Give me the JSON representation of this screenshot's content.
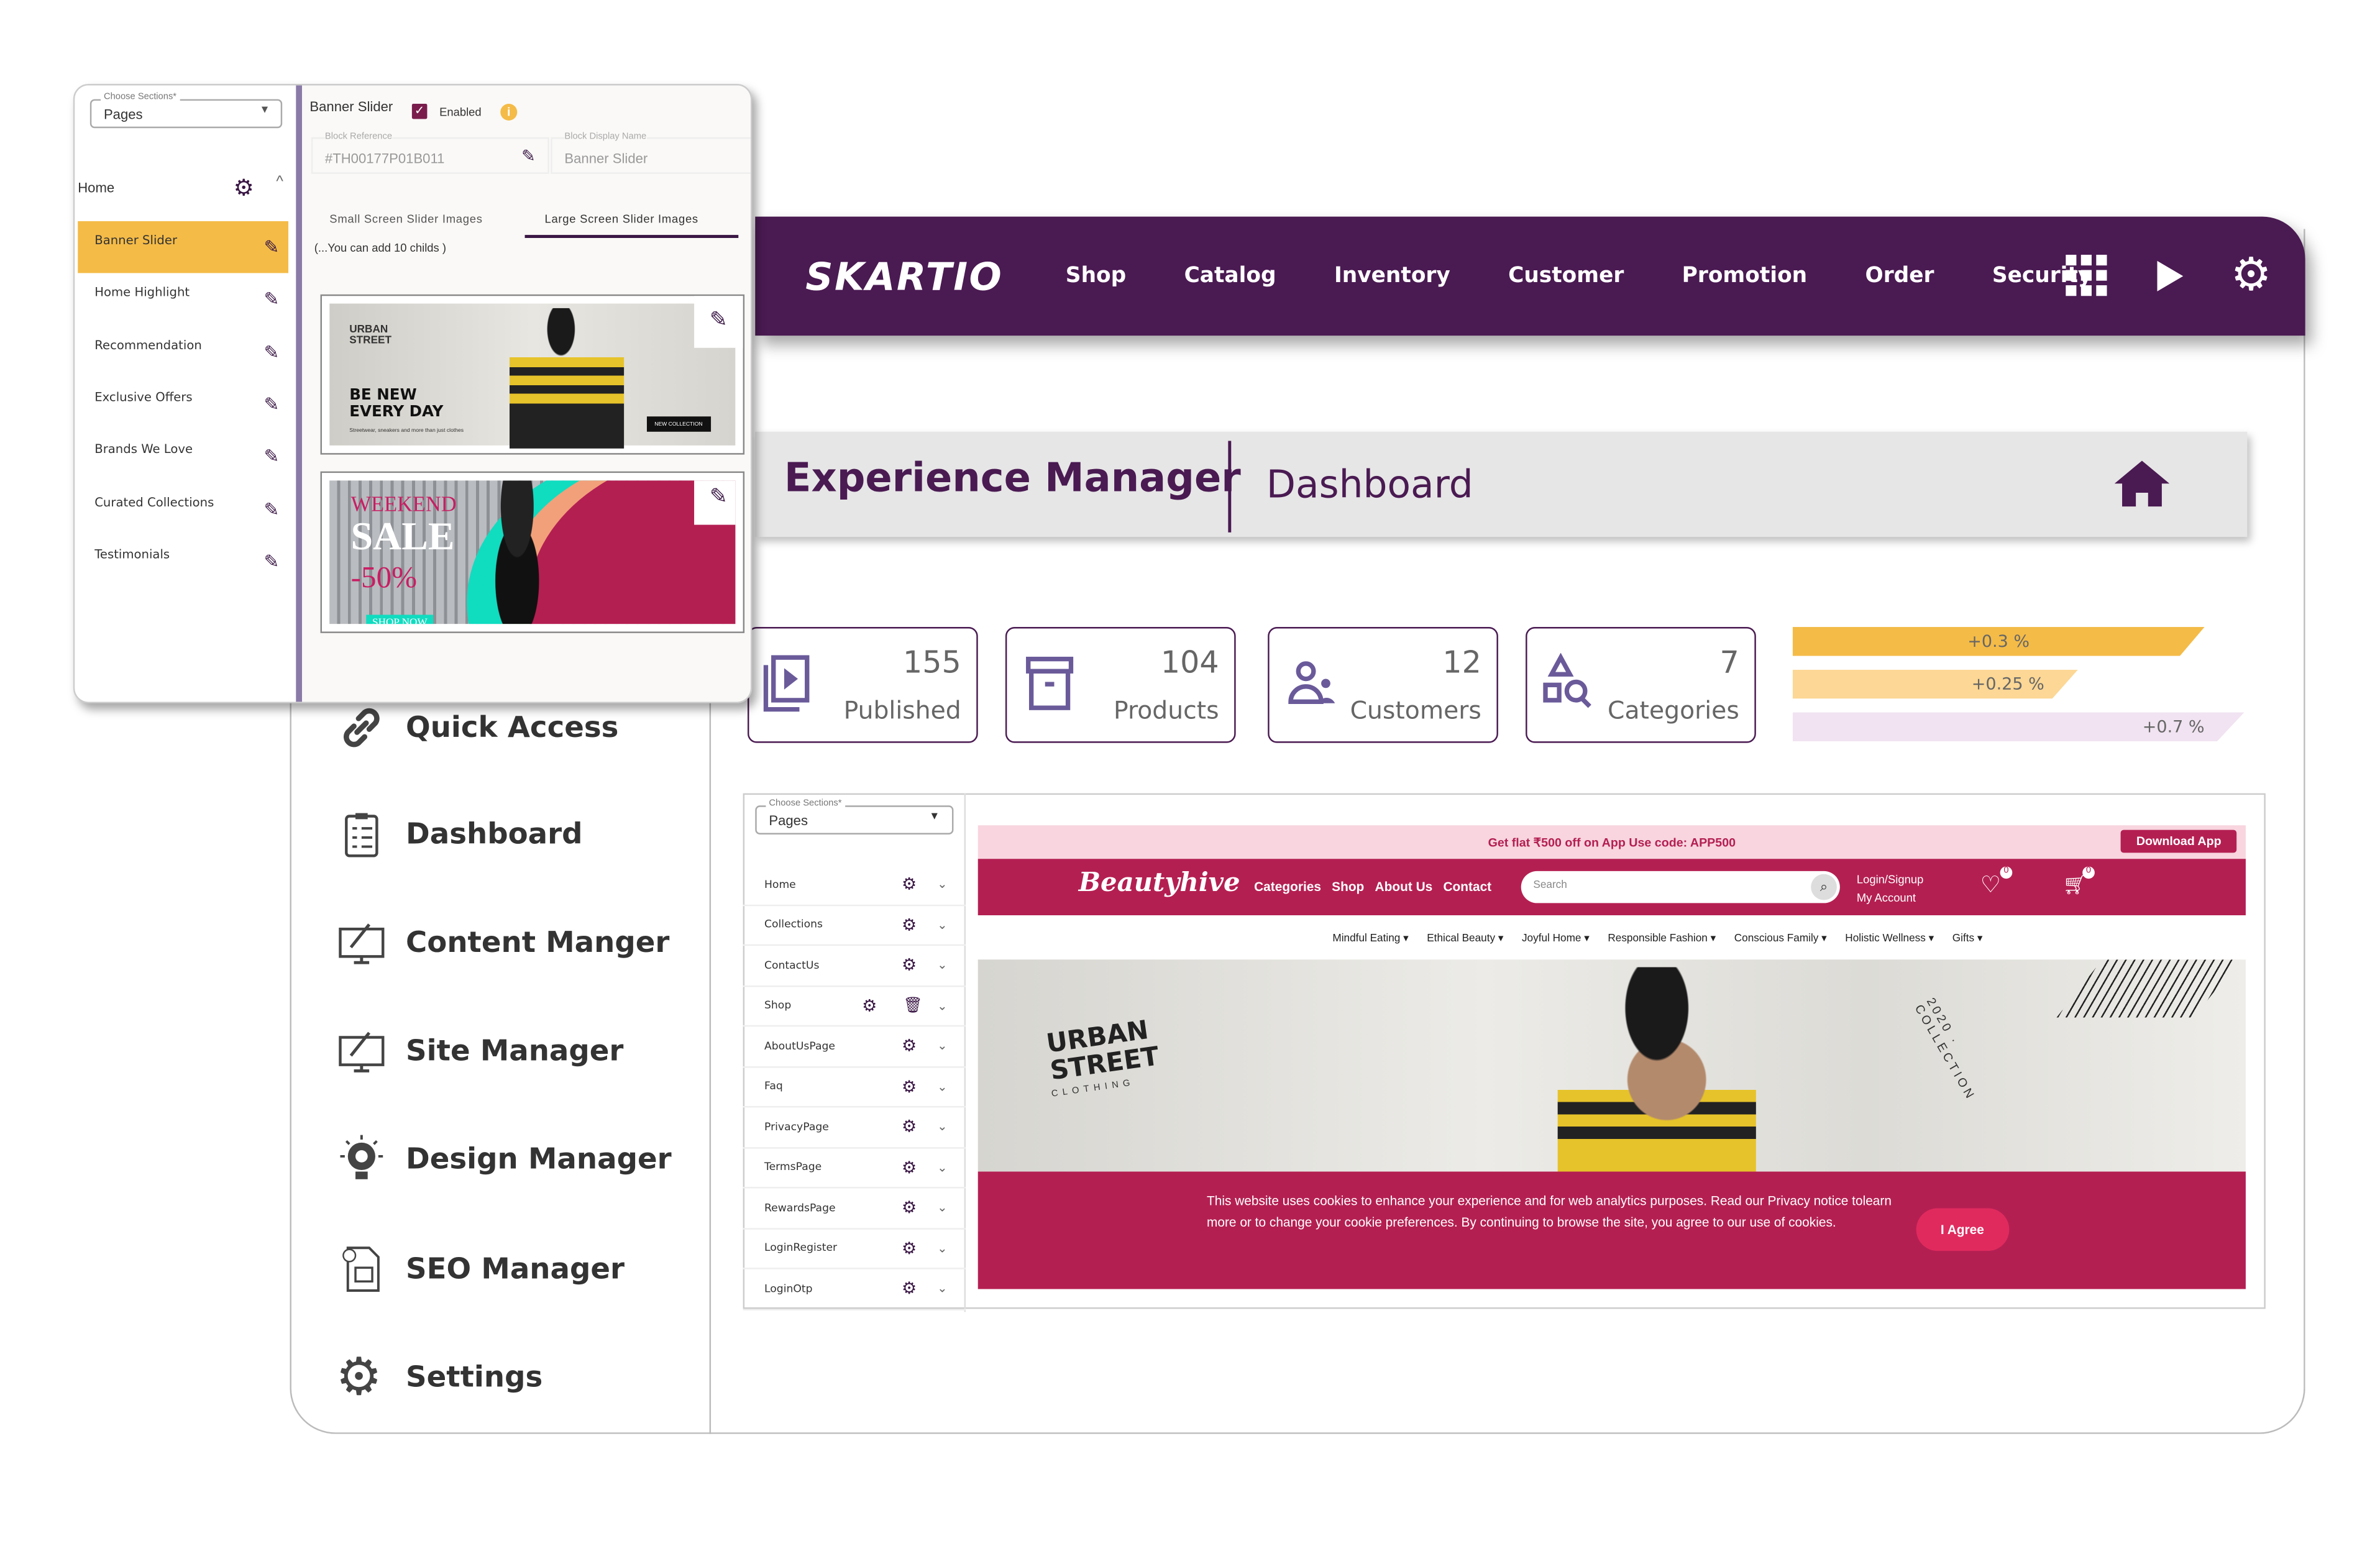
{
  "colors": {
    "brand": "#4a1a52",
    "accent": "#f4bb47",
    "site": "#b41f52",
    "promo_bg": "#f8d5df"
  },
  "navbar": {
    "logo": "SKARTIO",
    "items": [
      "Shop",
      "Catalog",
      "Inventory",
      "Customer",
      "Promotion",
      "Order",
      "Security"
    ],
    "icons": [
      "grid-icon",
      "play-icon",
      "gear-icon"
    ]
  },
  "sidebar": {
    "items": [
      {
        "label": "Quick Access",
        "icon": "link-icon"
      },
      {
        "label": "Dashboard",
        "icon": "clipboard-icon"
      },
      {
        "label": "Content Manger",
        "icon": "pen-monitor-icon"
      },
      {
        "label": "Site Manager",
        "icon": "pen-monitor-icon"
      },
      {
        "label": "Design Manager",
        "icon": "lightbulb-icon"
      },
      {
        "label": "SEO Manager",
        "icon": "seo-document-icon"
      },
      {
        "label": "Settings",
        "icon": "gear-icon"
      }
    ]
  },
  "header": {
    "title": "Experience Manager",
    "subtitle": "Dashboard",
    "icon": "home-icon"
  },
  "stats": [
    {
      "value": "155",
      "label": "Published"
    },
    {
      "value": "104",
      "label": "Products"
    },
    {
      "value": "12",
      "label": "Customers"
    },
    {
      "value": "7",
      "label": "Categories"
    }
  ],
  "trends": [
    {
      "label": "+0.3 %",
      "color": "#f4bb47"
    },
    {
      "label": "+0.25 %",
      "color": "#fcd795"
    },
    {
      "label": "+0.7 %",
      "color": "#f1e3f1"
    }
  ],
  "preview": {
    "section_legend": "Choose Sections*",
    "section_value": "Pages",
    "pages": [
      "Home",
      "Collections",
      "ContactUs",
      "Shop",
      "AboutUsPage",
      "Faq",
      "PrivacyPage",
      "TermsPage",
      "RewardsPage",
      "LoginRegister",
      "LoginOtp"
    ],
    "site": {
      "promo": "Get flat ₹500 off on App Use code: APP500",
      "download": "Download App",
      "logo": "Beautyhive",
      "links": [
        "Categories",
        "Shop",
        "About Us",
        "Contact"
      ],
      "search_placeholder": "Search",
      "login": "Login/Signup",
      "account": "My Account",
      "wishlist_count": "0",
      "cart_count": "0",
      "categories": [
        "Mindful Eating",
        "Ethical Beauty",
        "Joyful Home",
        "Responsible Fashion",
        "Conscious Family",
        "Holistic Wellness",
        "Gifts"
      ],
      "hero_brand": "URBAN STREET",
      "hero_brand_sub": "CLOTHING",
      "hero_collection": "2020 · COLLECTION",
      "cookie": "This website uses cookies to enhance your experience and for web analytics purposes. Read our Privacy notice tolearn more or to change your cookie preferences. By continuing to browse the site, you agree to our use of cookies.",
      "agree": "I Agree"
    }
  },
  "editor": {
    "section_legend": "Choose Sections*",
    "section_value": "Pages",
    "group": "Home",
    "blocks": [
      "Banner Slider",
      "Home Highlight",
      "Recommendation",
      "Exclusive Offers",
      "Brands We Love",
      "Curated Collections",
      "Testimonials"
    ],
    "block_title": "Banner Slider",
    "enabled_label": "Enabled",
    "enabled": true,
    "ref_legend": "Block Reference",
    "ref_value": "#TH00177P01B011",
    "name_legend": "Block Display Name",
    "name_value": "Banner Slider",
    "tabs": [
      "Small Screen Slider Images",
      "Large Screen Slider Images"
    ],
    "active_tab": 1,
    "hint": "(...You can add 10 childs )",
    "slide1": {
      "brand": "URBAN STREET",
      "headline1": "BE NEW",
      "headline2": "EVERY DAY",
      "tagline": "Streetwear, sneakers and more than just clothes",
      "button": "NEW COLLECTION"
    },
    "slide2": {
      "line1": "WEEKEND",
      "line2": "SALE",
      "discount": "-50%",
      "button": "SHOP NOW"
    }
  }
}
